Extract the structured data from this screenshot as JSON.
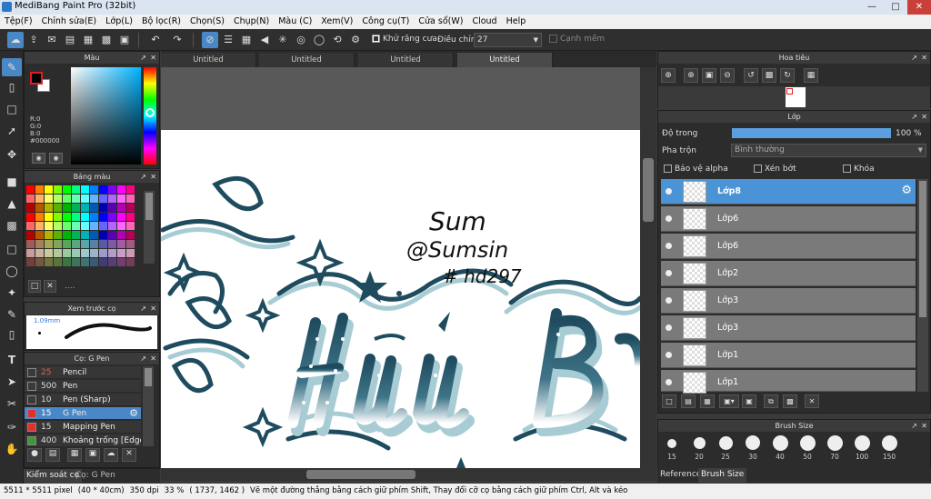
{
  "app": {
    "title": "MediBang Paint Pro (32bit)"
  },
  "menu": [
    "Tệp(F)",
    "Chỉnh sửa(E)",
    "Lớp(L)",
    "Bộ lọc(R)",
    "Chọn(S)",
    "Chụp(N)",
    "Màu (C)",
    "Xem(V)",
    "Công cụ(T)",
    "Cửa sổ(W)",
    "Cloud",
    "Help"
  ],
  "toolbar": {
    "antialias_label": "Khử răng cưa",
    "adjust_label": "Điều chỉnh",
    "adjust_value": "27",
    "sharp_label": "Cạnh mềm"
  },
  "color_panel": {
    "title": "Màu",
    "r": "R:0",
    "g": "G:0",
    "b": "B:0",
    "hex": "#000000",
    "primary": "#000000",
    "secondary": "#ffffff"
  },
  "palette_panel": {
    "title": "Bảng màu",
    "extra": "...."
  },
  "preview_panel": {
    "title": "Xem trước cọ",
    "size": "1.09mm"
  },
  "brush_panel": {
    "title": "Cọ: G Pen",
    "items": [
      {
        "size": "25",
        "name": "Pencil",
        "color": "#3a3a3a"
      },
      {
        "size": "500",
        "name": "Pen",
        "color": "#3a3a3a"
      },
      {
        "size": "10",
        "name": "Pen (Sharp)",
        "color": "#3a3a3a"
      },
      {
        "size": "15",
        "name": "G Pen",
        "color": "#e03030"
      },
      {
        "size": "15",
        "name": "Mapping Pen",
        "color": "#e03030"
      },
      {
        "size": "400",
        "name": "Khoảng trống [Edge",
        "color": "#3a9a3a"
      }
    ]
  },
  "left_tabs": [
    "Kiểm soát cọ",
    "Cọ: G Pen"
  ],
  "canvas_tabs": [
    "Untitled",
    "Untitled",
    "Untitled",
    "Untitled"
  ],
  "canvas_art": {
    "signature": [
      "Sum",
      "@Sumsin",
      "# hd297"
    ]
  },
  "navigator": {
    "title": "Hoa tiêu"
  },
  "layer_panel": {
    "title": "Lớp",
    "opacity_label": "Độ trong",
    "opacity_value": "100 %",
    "opacity_fraction": 1.0,
    "blend_label": "Pha trộn",
    "blend_value": "Bình thường",
    "protect_alpha": "Bảo vệ alpha",
    "clip": "Xén bớt",
    "lock": "Khóa",
    "layers": [
      "Lớp8",
      "Lớp6",
      "Lớp6",
      "Lớp2",
      "Lớp3",
      "Lớp3",
      "Lớp1",
      "Lớp1"
    ]
  },
  "brush_size": {
    "title": "Brush Size",
    "sizes": [
      "15",
      "20",
      "25",
      "30",
      "40",
      "50",
      "70",
      "100",
      "150"
    ],
    "tabs": [
      "Reference",
      "Brush Size"
    ]
  },
  "status": {
    "dims": "5511 * 5511 pixel",
    "physical": "(40 * 40cm)",
    "dpi": "350 dpi",
    "zoom": "33 %",
    "coords": "( 1737, 1462 )",
    "hint": "Vẽ một đường thẳng bằng cách giữ phím Shift, Thay đổi cỡ cọ bằng cách giữ phím Ctrl, Alt và kéo"
  }
}
